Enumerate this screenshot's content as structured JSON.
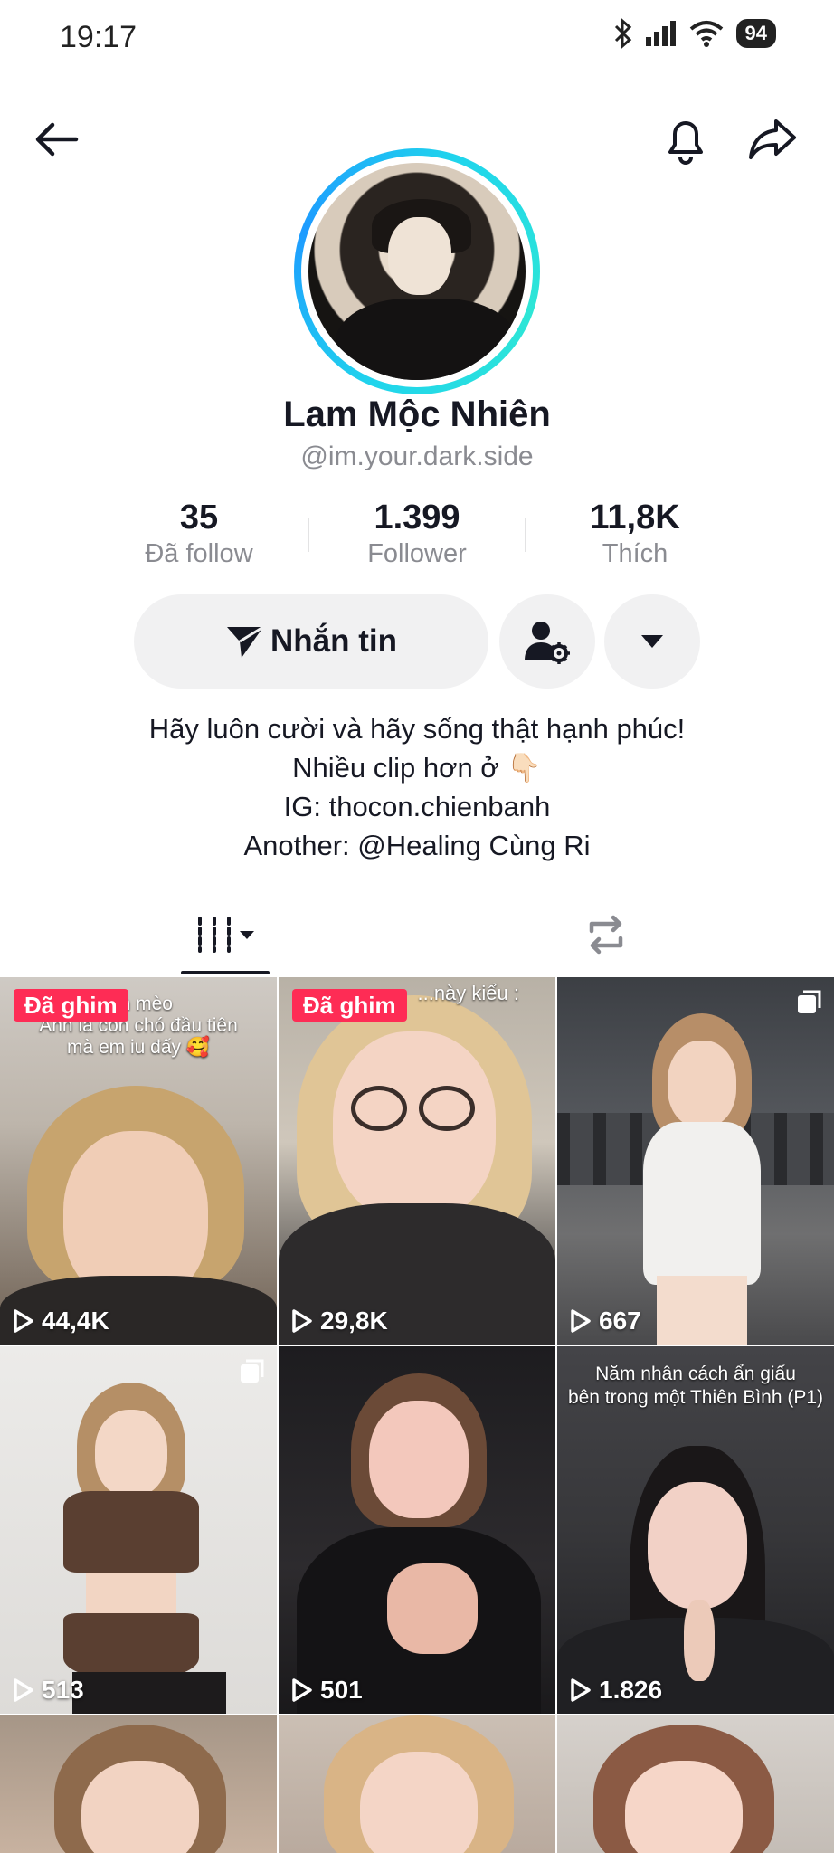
{
  "status_bar": {
    "time": "19:17",
    "battery": "94"
  },
  "profile": {
    "display_name": "Lam Mộc Nhiên",
    "username": "@im.your.dark.side"
  },
  "stats": [
    {
      "value": "35",
      "label": "Đã follow"
    },
    {
      "value": "1.399",
      "label": "Follower"
    },
    {
      "value": "11,8K",
      "label": "Thích"
    }
  ],
  "actions": {
    "message_label": "Nhắn tin"
  },
  "bio": {
    "line1": "Hãy luôn cười và hãy sống thật hạnh phúc!",
    "line2": "Nhiều clip hơn ở 👇🏻",
    "line3": "IG: thocon.chienbanh",
    "line4": "Another: @Healing Cùng Ri"
  },
  "videos": [
    {
      "pinned": "Đã ghim",
      "views": "44,4K",
      "caption": "...h mèo\nAnh là con chó đầu tiên\nmà em iu đấy 🥰"
    },
    {
      "pinned": "Đã ghim",
      "views": "29,8K",
      "caption": "...này kiểu :"
    },
    {
      "views": "667"
    },
    {
      "views": "513"
    },
    {
      "views": "501"
    },
    {
      "views": "1.826",
      "caption": "Năm nhân cách ẩn giấu\nbên trong một Thiên Bình (P1)"
    }
  ],
  "colors": {
    "accent": "#fe2c55",
    "ring_start": "#20d5ec",
    "ring_end": "#1e9bff",
    "button_bg": "#f1f1f2"
  }
}
